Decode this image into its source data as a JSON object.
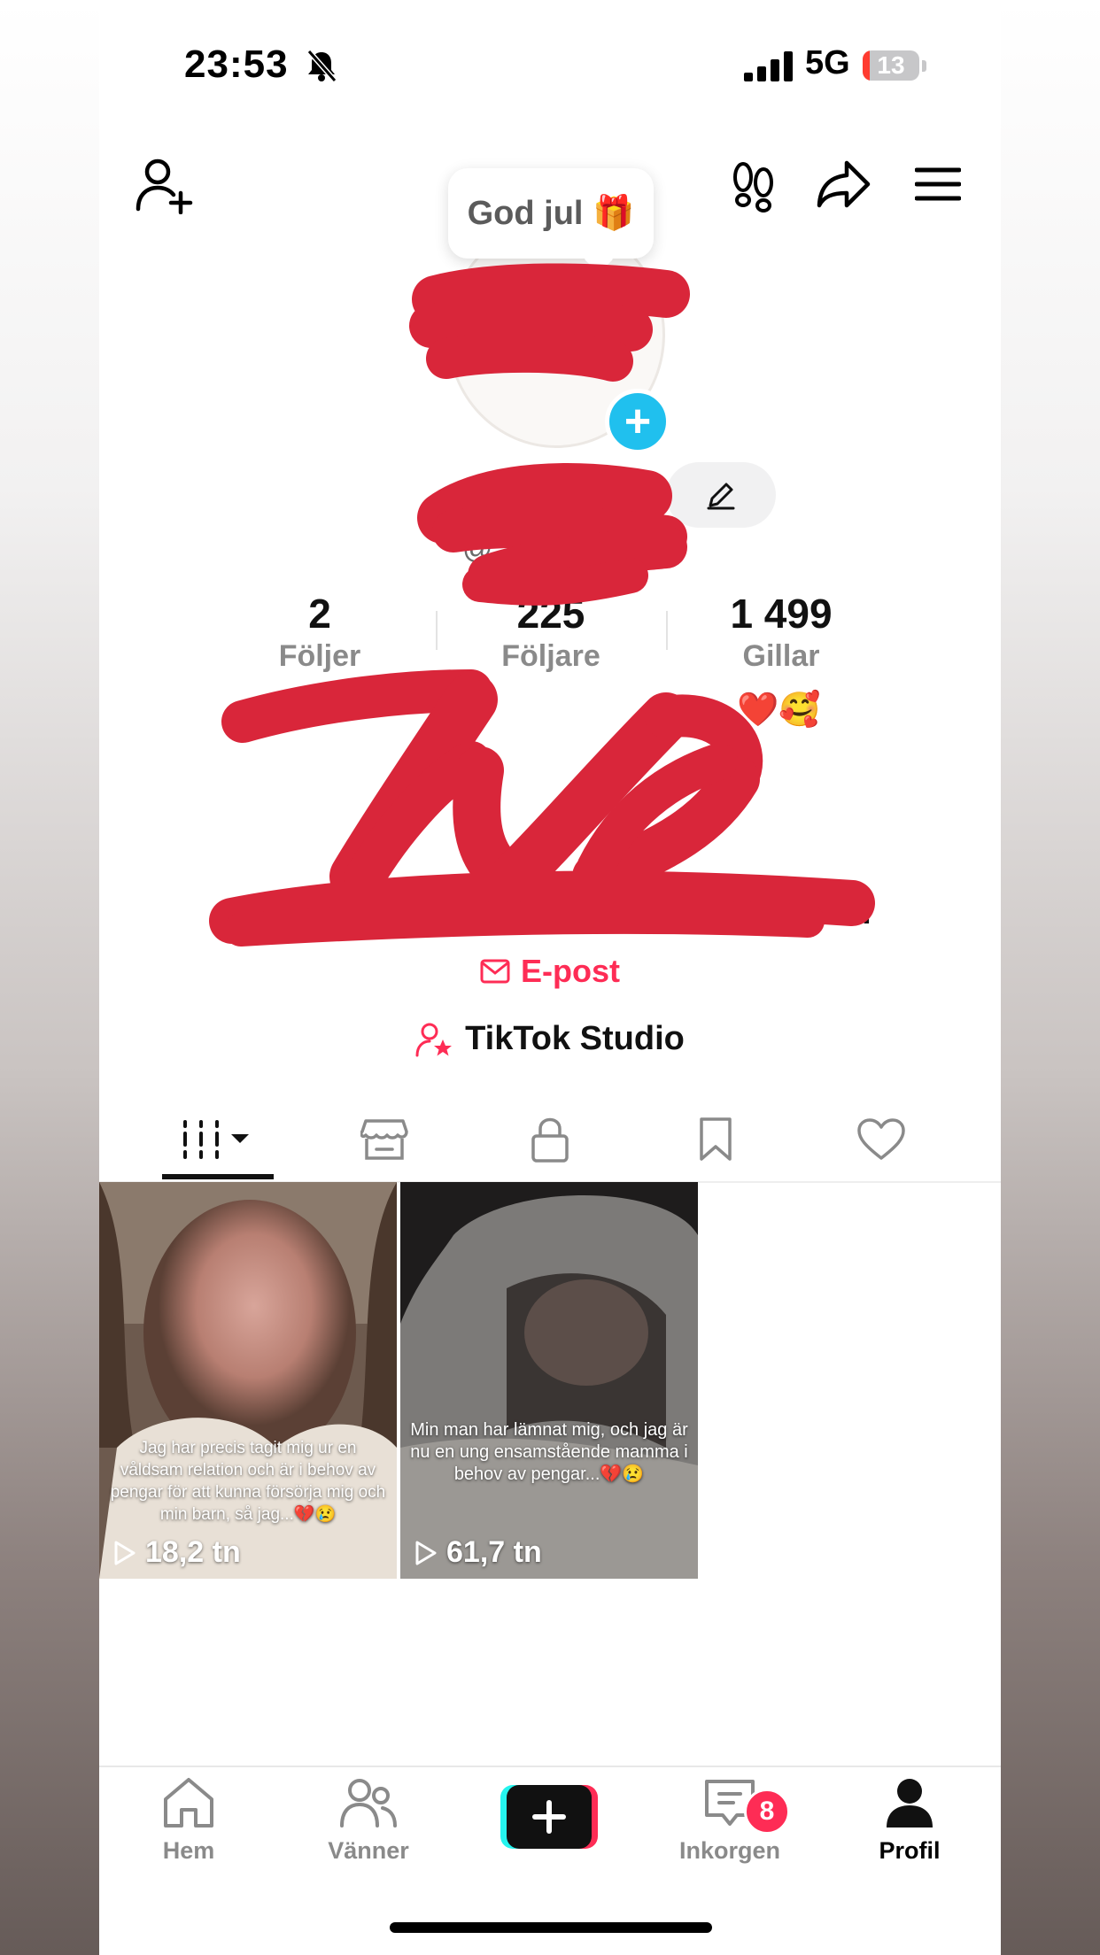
{
  "status": {
    "time": "23:53",
    "network": "5G",
    "battery": "13",
    "battery_fraction": 0.13
  },
  "tooltip": {
    "text": "God jul 🎁"
  },
  "profile": {
    "handle_prefix": "@"
  },
  "stats": [
    {
      "value": "2",
      "label": "Följer"
    },
    {
      "value": "225",
      "label": "Följare"
    },
    {
      "value": "1 499",
      "label": "Gillar"
    }
  ],
  "bio": {
    "line1_emoji": "❤️🥰",
    "line5_end": "..."
  },
  "links": {
    "email_label": "E-post",
    "studio_label": "TikTok Studio"
  },
  "videos": [
    {
      "caption": "Jag har precis tagit mig ur en våldsam relation och är i behov av pengar för att kunna försörja mig och min barn, så jag...💔😢",
      "views": "18,2 tn"
    },
    {
      "caption": "Min man har lämnat mig, och jag är nu en ung ensamstående mamma i behov av pengar...💔😢",
      "views": "61,7 tn"
    }
  ],
  "nav": [
    {
      "label": "Hem"
    },
    {
      "label": "Vänner"
    },
    {
      "label": "Inkorgen",
      "badge": "8"
    },
    {
      "label": "Profil"
    }
  ],
  "colors": {
    "accent": "#fe2c55",
    "redaction": "#d9263a",
    "add_blue": "#20c0ee"
  }
}
